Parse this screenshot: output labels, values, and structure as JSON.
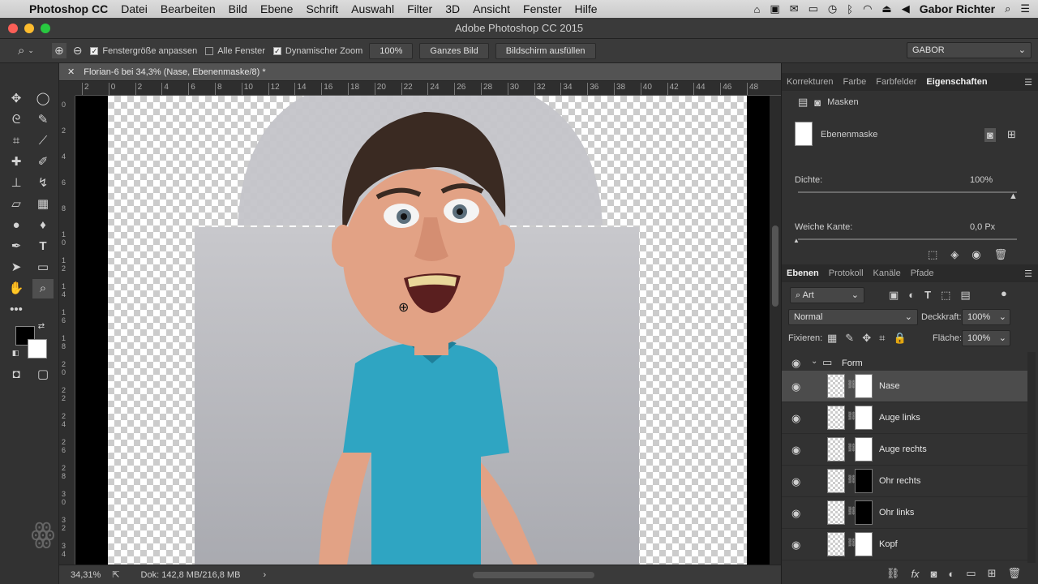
{
  "menubar": {
    "app_name": "Photoshop CC",
    "items": [
      "Datei",
      "Bearbeiten",
      "Bild",
      "Ebene",
      "Schrift",
      "Auswahl",
      "Filter",
      "3D",
      "Ansicht",
      "Fenster",
      "Hilfe"
    ],
    "user": "Gabor Richter"
  },
  "window": {
    "title": "Adobe Photoshop CC 2015"
  },
  "options": {
    "resize_windows": "Fenstergröße anpassen",
    "all_windows": "Alle Fenster",
    "scrubby_zoom": "Dynamischer Zoom",
    "zoom_value": "100%",
    "fit_screen": "Ganzes Bild",
    "fill_screen": "Bildschirm ausfüllen",
    "workspace": "GABOR"
  },
  "document": {
    "tab_title": "Florian-6 bei 34,3% (Nase, Ebenenmaske/8) *",
    "ruler_top": [
      "2",
      "0",
      "2",
      "4",
      "6",
      "8",
      "10",
      "12",
      "14",
      "16",
      "18",
      "20",
      "22",
      "24",
      "26",
      "28",
      "30",
      "32",
      "34",
      "36",
      "38",
      "40",
      "42",
      "44",
      "46",
      "48"
    ],
    "ruler_left": [
      "0",
      "2",
      "4",
      "6",
      "8",
      "1​0",
      "1​2",
      "1​4",
      "1​6",
      "1​8",
      "2​0",
      "2​2",
      "2​4",
      "2​6",
      "2​8",
      "3​0",
      "3​2",
      "3​4",
      "3​6",
      "3​8"
    ],
    "zoom": "34,31%",
    "doc_info": "Dok: 142,8 MB/216,8 MB"
  },
  "properties": {
    "tabs": [
      "Korrekturen",
      "Farbe",
      "Farbfelder",
      "Eigenschaften"
    ],
    "active_tab": "Eigenschaften",
    "section": "Masken",
    "mask_label": "Ebenenmaske",
    "density_label": "Dichte:",
    "density_value": "100%",
    "feather_label": "Weiche Kante:",
    "feather_value": "0,0 Px"
  },
  "layers": {
    "tabs": [
      "Ebenen",
      "Protokoll",
      "Kanäle",
      "Pfade"
    ],
    "filter_kind": "Art",
    "blend_mode": "Normal",
    "opacity_label": "Deckkraft:",
    "opacity_value": "100%",
    "lock_label": "Fixieren:",
    "fill_label": "Fläche:",
    "fill_value": "100%",
    "group_name": "Form",
    "items": [
      {
        "name": "Nase",
        "selected": true
      },
      {
        "name": "Auge links",
        "selected": false
      },
      {
        "name": "Auge rechts",
        "selected": false
      },
      {
        "name": "Ohr rechts",
        "selected": false
      },
      {
        "name": "Ohr links",
        "selected": false
      },
      {
        "name": "Kopf",
        "selected": false
      }
    ]
  },
  "colors": {
    "foreground": "#000000",
    "background": "#ffffff",
    "shirt": "#2fa5c2",
    "skin": "#e2a285",
    "hair": "#3a2a22"
  }
}
